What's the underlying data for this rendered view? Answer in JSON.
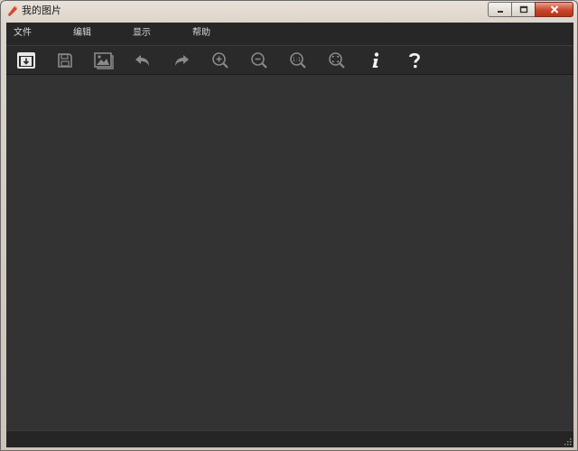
{
  "window": {
    "title": "我的图片"
  },
  "menu": {
    "items": [
      "文件",
      "编辑",
      "显示",
      "帮助"
    ]
  },
  "toolbar": {
    "buttons": [
      "open-folder-icon",
      "save-icon",
      "image-icon",
      "undo-icon",
      "redo-icon",
      "zoom-in-icon",
      "zoom-out-icon",
      "actual-size-icon",
      "fit-to-window-icon",
      "info-icon",
      "help-icon"
    ],
    "actual_size_label": "1:1"
  },
  "colors": {
    "client_background": "#333333",
    "menubar_background": "#272727",
    "toolbar_background": "#2a2a2a",
    "close_button": "#c8442b"
  }
}
